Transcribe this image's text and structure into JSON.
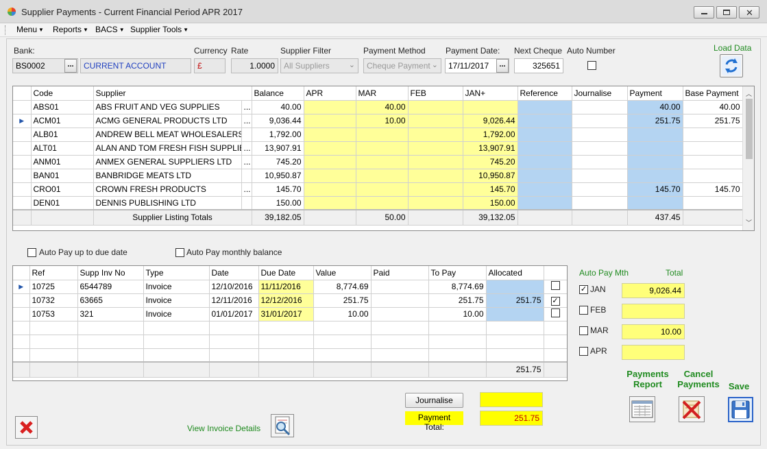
{
  "window": {
    "title": "Supplier Payments - Current Financial Period APR 2017"
  },
  "menu": [
    {
      "label": "Menu"
    },
    {
      "label": "Reports"
    },
    {
      "label": "BACS"
    },
    {
      "label": "Supplier Tools"
    }
  ],
  "header": {
    "bank_label": "Bank:",
    "bank_code": "BS0002",
    "bank_name": "CURRENT ACCOUNT",
    "currency_label": "Currency",
    "currency_symbol": "£",
    "rate_label": "Rate",
    "rate_value": "1.0000",
    "supplier_filter_label": "Supplier Filter",
    "supplier_filter_value": "All Suppliers",
    "payment_method_label": "Payment Method",
    "payment_method_value": "Cheque Payment",
    "payment_date_label": "Payment Date:",
    "payment_date_value": "17/11/2017",
    "next_cheque_label": "Next Cheque",
    "next_cheque_value": "325651",
    "auto_number_label": "Auto Number",
    "load_data_label": "Load Data",
    "ellipsis": "..."
  },
  "suppliers_grid": {
    "columns": [
      "Code",
      "Supplier",
      "Balance",
      "APR",
      "MAR",
      "FEB",
      "JAN+",
      "Reference",
      "Journalise",
      "Payment",
      "Base Payment"
    ],
    "rows": [
      {
        "code": "ABS01",
        "supplier": "ABS  FRUIT AND VEG SUPPLIES",
        "more": "...",
        "balance": "40.00",
        "apr": "",
        "mar": "40.00",
        "feb": "",
        "jan": "",
        "reference": "",
        "journalise": "",
        "payment": "40.00",
        "base_payment": "40.00"
      },
      {
        "code": "ACM01",
        "supplier": "ACMG GENERAL PRODUCTS LTD",
        "more": "...",
        "balance": "9,036.44",
        "apr": "",
        "mar": "10.00",
        "feb": "",
        "jan": "9,026.44",
        "reference": "",
        "journalise": "",
        "payment": "251.75",
        "base_payment": "251.75"
      },
      {
        "code": "ALB01",
        "supplier": "ANDREW BELL MEAT WHOLESALERS",
        "more": "",
        "balance": "1,792.00",
        "apr": "",
        "mar": "",
        "feb": "",
        "jan": "1,792.00",
        "reference": "",
        "journalise": "",
        "payment": "",
        "base_payment": ""
      },
      {
        "code": "ALT01",
        "supplier": "ALAN AND TOM FRESH FISH SUPPLIES",
        "more": "...",
        "balance": "13,907.91",
        "apr": "",
        "mar": "",
        "feb": "",
        "jan": "13,907.91",
        "reference": "",
        "journalise": "",
        "payment": "",
        "base_payment": ""
      },
      {
        "code": "ANM01",
        "supplier": "ANMEX GENERAL SUPPLIERS LTD",
        "more": "...",
        "balance": "745.20",
        "apr": "",
        "mar": "",
        "feb": "",
        "jan": "745.20",
        "reference": "",
        "journalise": "",
        "payment": "",
        "base_payment": ""
      },
      {
        "code": "BAN01",
        "supplier": "BANBRIDGE MEATS LTD",
        "more": "",
        "balance": "10,950.87",
        "apr": "",
        "mar": "",
        "feb": "",
        "jan": "10,950.87",
        "reference": "",
        "journalise": "",
        "payment": "",
        "base_payment": ""
      },
      {
        "code": "CRO01",
        "supplier": "CROWN FRESH  PRODUCTS",
        "more": "...",
        "balance": "145.70",
        "apr": "",
        "mar": "",
        "feb": "",
        "jan": "145.70",
        "reference": "",
        "journalise": "",
        "payment": "145.70",
        "base_payment": "145.70"
      },
      {
        "code": "DEN01",
        "supplier": "DENNIS PUBLISHING LTD",
        "more": "",
        "balance": "150.00",
        "apr": "",
        "mar": "",
        "feb": "",
        "jan": "150.00",
        "reference": "",
        "journalise": "",
        "payment": "",
        "base_payment": ""
      }
    ],
    "totals": {
      "label": "Supplier Listing Totals",
      "balance": "39,182.05",
      "mar": "50.00",
      "jan": "39,132.05",
      "payment": "437.45"
    }
  },
  "options": {
    "auto_pay_due": "Auto Pay up to due date",
    "auto_pay_monthly": "Auto Pay monthly balance"
  },
  "invoices_grid": {
    "columns": [
      "Ref",
      "Supp Inv No",
      "Type",
      "Date",
      "Due Date",
      "Value",
      "Paid",
      "To Pay",
      "Allocated"
    ],
    "rows": [
      {
        "ref": "10725",
        "inv": "6544789",
        "type": "Invoice",
        "date": "12/10/2016",
        "due": "11/11/2016",
        "value": "8,774.69",
        "paid": "",
        "topay": "8,774.69",
        "allocated": "",
        "checked": ""
      },
      {
        "ref": "10732",
        "inv": "63665",
        "type": "Invoice",
        "date": "12/11/2016",
        "due": "12/12/2016",
        "value": "251.75",
        "paid": "",
        "topay": "251.75",
        "allocated": "251.75",
        "checked": "✓"
      },
      {
        "ref": "10753",
        "inv": "321",
        "type": "Invoice",
        "date": "01/01/2017",
        "due": "31/01/2017",
        "value": "10.00",
        "paid": "",
        "topay": "10.00",
        "allocated": "",
        "checked": ""
      }
    ],
    "total_allocated": "251.75"
  },
  "auto_pay": {
    "header_month": "Auto Pay Mth",
    "header_total": "Total",
    "months": [
      {
        "label": "JAN",
        "checked": "✓",
        "total": "9,026.44"
      },
      {
        "label": "FEB",
        "checked": "",
        "total": ""
      },
      {
        "label": "MAR",
        "checked": "",
        "total": "10.00"
      },
      {
        "label": "APR",
        "checked": "",
        "total": ""
      }
    ]
  },
  "actions": {
    "payments_report": "Payments Report",
    "payments_report_l1": "Payments",
    "payments_report_l2": "Report",
    "cancel_payments_l1": "Cancel",
    "cancel_payments_l2": "Payments",
    "save": "Save",
    "journalise": "Journalise",
    "journalise_value": "",
    "payment_total_label": "Payment Total:",
    "payment_total_value": "251.75",
    "view_invoice_details": "View Invoice Details"
  },
  "colors": {
    "highlight_yellow": "#ffff99",
    "highlight_blue": "#b4d4f2",
    "accent_green": "#1e8a1e",
    "bank_name_blue": "#1f3fbf",
    "currency_red": "#c00000"
  }
}
